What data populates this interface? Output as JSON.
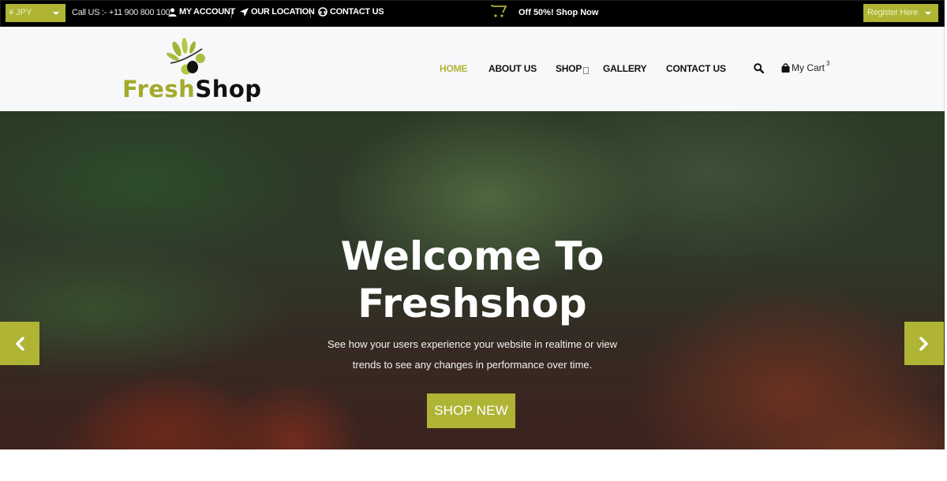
{
  "topbar": {
    "currency": "¥ JPY",
    "call": "Call US :- +11 900 800 100",
    "links": [
      {
        "label": "MY ACCOUNT",
        "icon": "user-icon"
      },
      {
        "label": "OUR LOCATION",
        "icon": "location-arrow-icon"
      },
      {
        "label": "CONTACT US",
        "icon": "headset-icon"
      }
    ],
    "offer": "Off 50%! Shop Now",
    "register": "Register Here"
  },
  "brand": {
    "fresh": "Fresh",
    "shop": "Shop",
    "accent_color": "#b0b435"
  },
  "nav": {
    "items": [
      {
        "label": "HOME",
        "active": true
      },
      {
        "label": "ABOUT US"
      },
      {
        "label": "SHOP"
      },
      {
        "label": "GALLERY"
      },
      {
        "label": "CONTACT US"
      }
    ],
    "cart_label": "My Cart",
    "cart_count": "3"
  },
  "hero": {
    "title_line1": "Welcome To",
    "title_line2": "Freshshop",
    "subtitle_line1": "See how your users experience your website in realtime or view",
    "subtitle_line2": "trends to see any changes in performance over time.",
    "button": "SHOP NEW"
  }
}
